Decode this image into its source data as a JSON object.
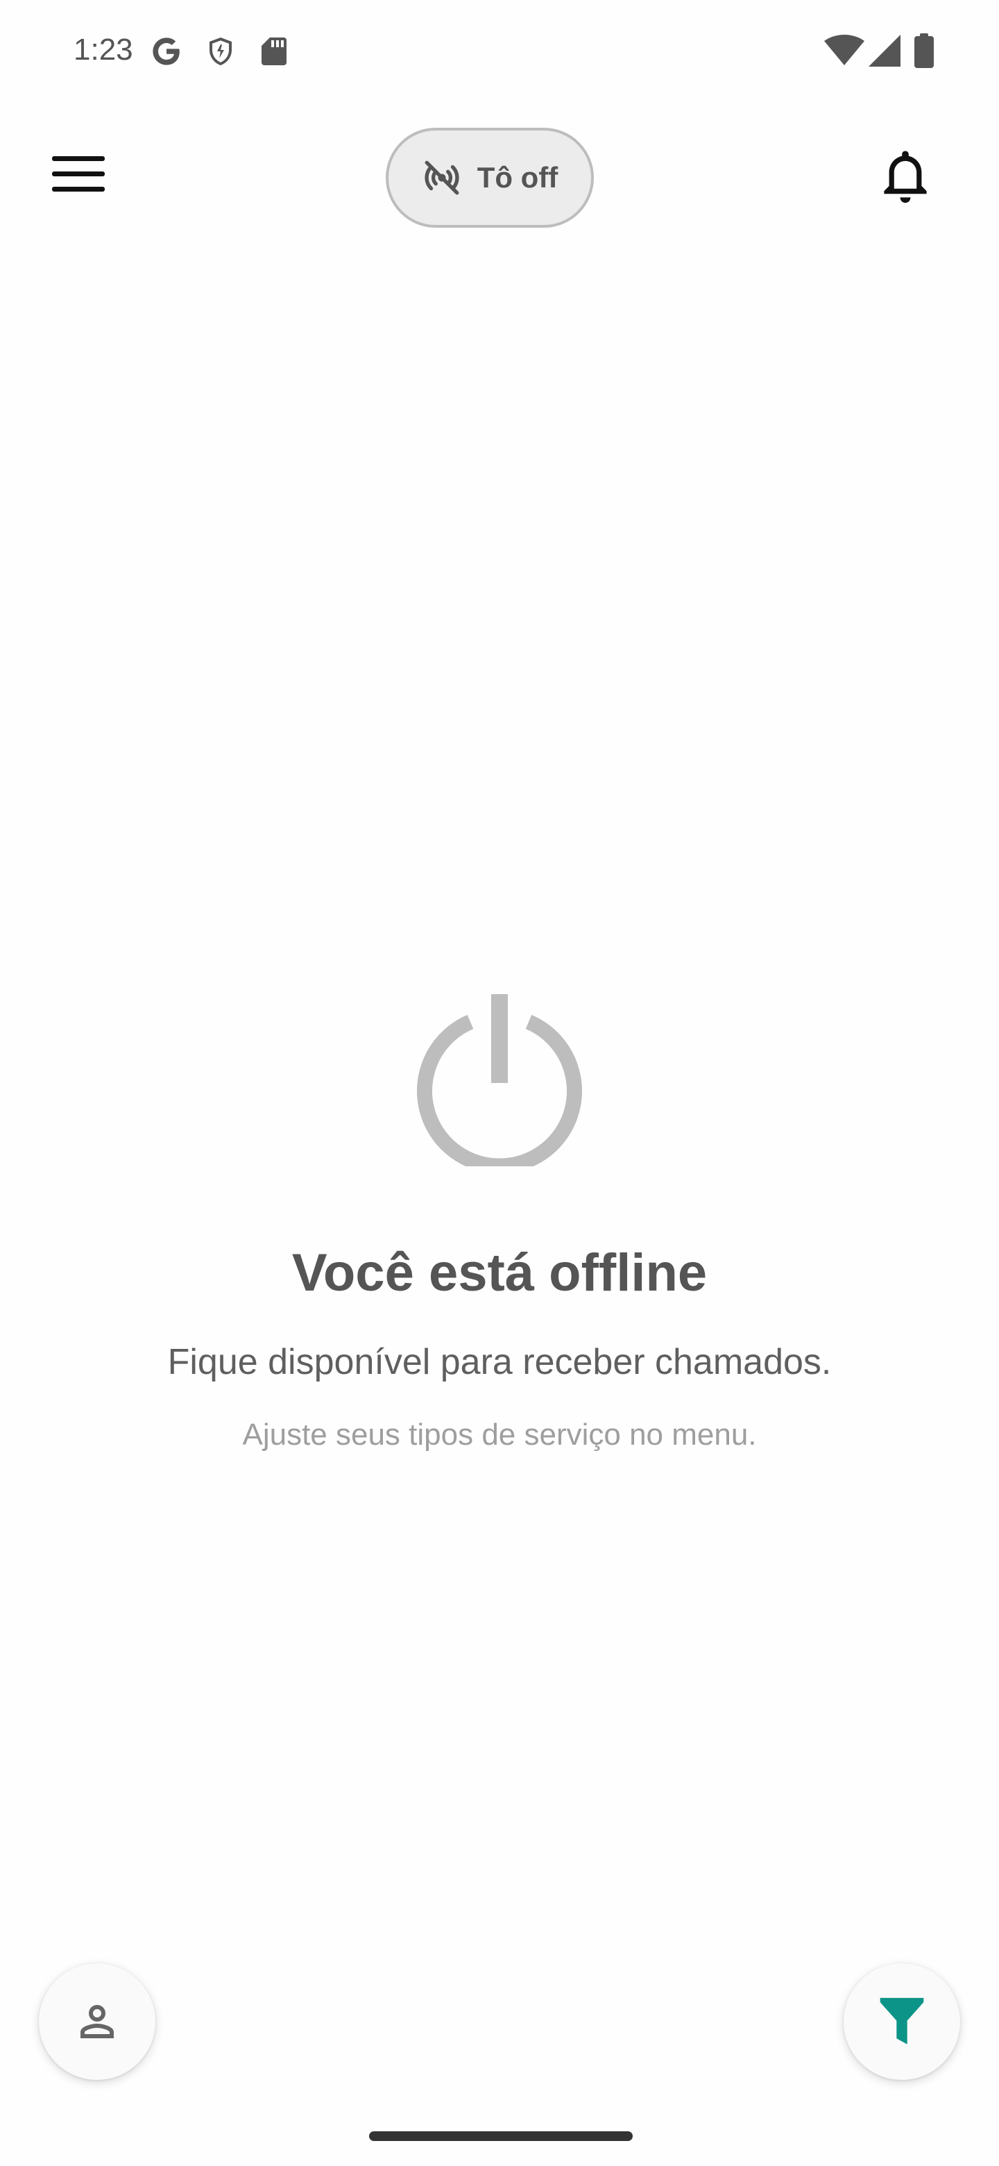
{
  "status_bar": {
    "time": "1:23",
    "left_icons": [
      "google-icon",
      "shield-icon",
      "sd-card-icon"
    ],
    "right_icons": [
      "wifi-icon",
      "cellular-signal-icon",
      "battery-icon"
    ]
  },
  "top_bar": {
    "menu_icon": "hamburger-menu-icon",
    "status_toggle": {
      "icon": "broadcast-off-icon",
      "label": "Tô off"
    },
    "notifications_icon": "bell-icon"
  },
  "empty_state": {
    "icon": "power-icon",
    "title": "Você está offline",
    "subtitle": "Fique disponível para receber chamados.",
    "hint": "Ajuste seus tipos de serviço no menu."
  },
  "bottom": {
    "profile_icon": "person-icon",
    "filter_icon": "filter-icon"
  },
  "colors": {
    "accent": "#0d9488",
    "muted_icon": "#bdbdbd",
    "text_primary": "#555555",
    "text_secondary": "#5f5f5f",
    "text_hint": "#9e9e9e"
  }
}
